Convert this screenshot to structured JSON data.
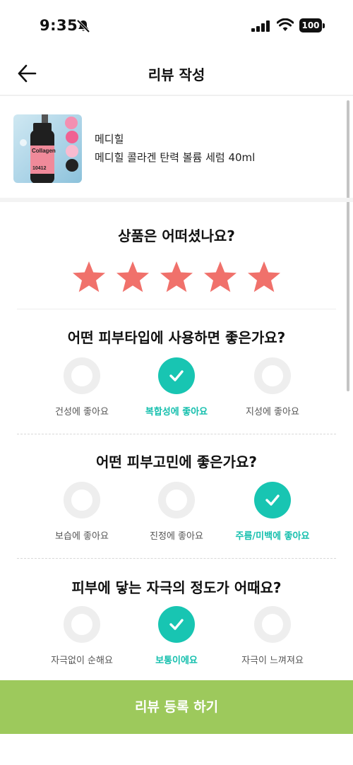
{
  "status_bar": {
    "time": "9:35",
    "battery": "100"
  },
  "header": {
    "title": "리뷰 작성"
  },
  "product": {
    "brand": "메디힐",
    "name": "메디힐 콜라겐 탄력 볼륨 세럼 40ml",
    "image_text": "Collagen",
    "image_code": "10412"
  },
  "rating": {
    "question": "상품은 어떠셨나요?",
    "value": 5,
    "max": 5,
    "star_color": "#f0716b"
  },
  "skin_type": {
    "question": "어떤 피부타입에 사용하면 좋은가요?",
    "options": [
      {
        "label": "건성에 좋아요",
        "selected": false
      },
      {
        "label": "복합성에 좋아요",
        "selected": true
      },
      {
        "label": "지성에 좋아요",
        "selected": false
      }
    ]
  },
  "skin_concern": {
    "question": "어떤 피부고민에 좋은가요?",
    "options": [
      {
        "label": "보습에 좋아요",
        "selected": false
      },
      {
        "label": "진정에 좋아요",
        "selected": false
      },
      {
        "label": "주름/미백에 좋아요",
        "selected": true
      }
    ]
  },
  "irritation": {
    "question": "피부에 닿는 자극의 정도가 어때요?",
    "options": [
      {
        "label": "자극없이 순해요",
        "selected": false
      },
      {
        "label": "보통이에요",
        "selected": true
      },
      {
        "label": "자극이 느껴져요",
        "selected": false
      }
    ]
  },
  "submit": {
    "label": "리뷰 등록 하기"
  },
  "colors": {
    "accent": "#18c5b2",
    "submit": "#9dc95c",
    "star": "#f0716b"
  },
  "icons": {
    "back": "arrow-left-icon",
    "check": "check-icon",
    "star": "star-icon"
  }
}
